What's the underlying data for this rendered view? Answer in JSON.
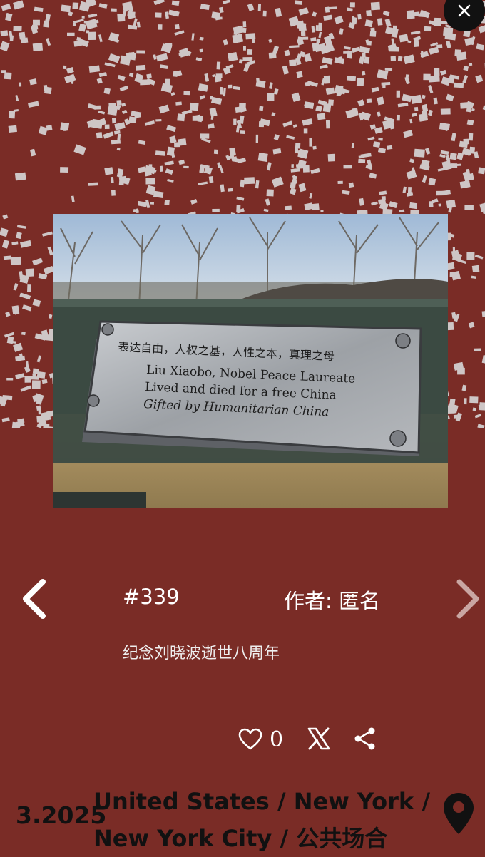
{
  "close": {
    "icon": "close-icon"
  },
  "photo": {
    "plaque_line1": "表达自由，人权之基，人性之本，真理之母",
    "plaque_line2": "Liu Xiaobo, Nobel Peace Laureate",
    "plaque_line3": "Lived and died for a free China",
    "plaque_line4": "Gifted by Humanitarian China"
  },
  "post": {
    "id": "#339",
    "author": "作者: 匿名",
    "caption": "纪念刘晓波逝世八周年"
  },
  "actions": {
    "like_count": "0",
    "like_icon": "heart-icon",
    "x_icon": "x-logo-icon",
    "share_icon": "share-icon"
  },
  "footer": {
    "date": "3.2025",
    "location_line1": "United States / New York /",
    "location_line2": "New York City / 公共场合",
    "pin_icon": "map-pin-icon"
  },
  "colors": {
    "background": "#7a2c26",
    "map_blocks": "#c8c8c8",
    "text": "#ffffff",
    "footer_text": "#111111"
  }
}
